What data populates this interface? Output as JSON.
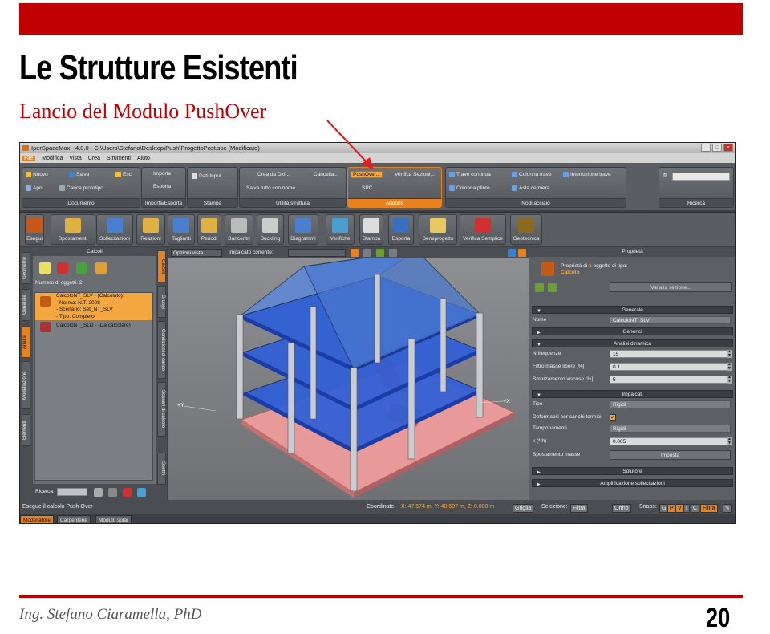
{
  "slide": {
    "title": "Le Strutture Esistenti",
    "subtitle": "Lancio del Modulo PushOver",
    "author": "Ing. Stefano Ciaramella, PhD",
    "page_number": "20",
    "accent_color": "#c00000"
  },
  "window": {
    "title": "IperSpaceMax - 4.0.0 - C:\\Users\\Stefano\\Desktop\\Push\\ProgettoPost.spc (Modificato)"
  },
  "menu": [
    "File",
    "Modifica",
    "Vista",
    "Crea",
    "Strumenti",
    "Aiuto"
  ],
  "ribbon": {
    "documento": {
      "label": "Documento",
      "nuovo": "Nuovo",
      "salva": "Salva",
      "esci": "Esci",
      "apri": "Apri...",
      "carica": "Carica prototipo..."
    },
    "importa": {
      "label": "Importa/Esporta",
      "importa": "Importa",
      "esporta": "Esporta"
    },
    "stampa": {
      "label": "Stampa",
      "dati": "Dati Input"
    },
    "utilita": {
      "label": "Utilità struttura",
      "crea": "Crea da Dxf...",
      "cancella": "Cancella...",
      "salva": "Salva tutto con nome..."
    },
    "addons": {
      "label": "Addons",
      "pushover": "PushOver...",
      "verifica": "Verifica Sezioni...",
      "spc": "SPC..."
    },
    "nodi": {
      "label": "Nodi acciaio",
      "trave_continua": "Trave continua",
      "colonna_trave": "Colonna trave",
      "interruzione": "Interruzione trave",
      "colonna_plinto": "Colonna plinto",
      "asta_cerniera": "Asta cerniera"
    },
    "ricerca": {
      "label": "Ricerca"
    }
  },
  "toolbar": [
    "Esegui",
    "Spostamenti",
    "Sollecitazioni",
    "Reazioni",
    "Taglianti",
    "Periodi",
    "Baricentri",
    "Buckling",
    "Diagrammi",
    "Verifiche",
    "Stampa",
    "Esporta",
    "Semiprogetto",
    "Verifica Semplice",
    "Geotecnica"
  ],
  "left_tabs": [
    "Geometrie",
    "Generale",
    "Analisi",
    "Modellazione",
    "Elementi"
  ],
  "calc_panel": {
    "header": "Calcoli",
    "num_objects": "Numero di oggetti: 2",
    "items": [
      {
        "lines": [
          "CalcoloNT_SLV - (Calcolato):",
          " - Norma: N.T. 2008",
          " - Scenario: Set_NT_SLV",
          " - Tipo: Completo"
        ]
      },
      {
        "lines": [
          "CalcoloNT_SLD - (Da calcolare)"
        ]
      }
    ],
    "search_label": "Ricerca:"
  },
  "mid_tabs": [
    "Calcoli",
    "Gruppi",
    "Condizioni di carico",
    "Scenari di calcolo",
    "Spettri"
  ],
  "viewport": {
    "options": "Opzioni vista...",
    "impalcato": "Impalcato corrente:",
    "axis_x": "+X",
    "axis_y": "+Y"
  },
  "properties": {
    "header": "Proprietà",
    "info_line1": "Proprietà di ",
    "info_count": "1",
    "info_line1b": " oggetto di tipo:",
    "info_type": "Calcolo",
    "vai": "Vai alla sezione...",
    "sections": {
      "generale": "Generale",
      "generici": "Generici",
      "analisi": "Analisi dinamica",
      "impalcati": "Impalcati",
      "solutore": "Solutore",
      "amplificazione": "Amplificazione sollecitazioni"
    },
    "nome_label": "Nome",
    "nome_value": "CalcoloNT_SLV",
    "n_freq_label": "N frequenze",
    "n_freq_value": "15",
    "filtro_label": "Filtro masse libere [%]",
    "filtro_value": "0.1",
    "smorz_label": "Smorzamento viscoso [%]",
    "smorz_value": "5",
    "tipo_label": "Tipo",
    "tipo_value": "Rigidi",
    "deform_label": "Deformabili per carichi termici",
    "tamp_label": "Tamponamenti",
    "tamp_value": "Rigidi",
    "k_label": "k (* h)",
    "k_value": "0.005",
    "sposta_label": "Spostamento masse",
    "imposta": "Imposta"
  },
  "status": {
    "message": "Esegue il calcolo Push Over",
    "coord_label": "Coordinate:",
    "coord_value": "X: 47.574 m, Y: 40.607 m, Z: 0.000 m",
    "griglia": "Griglia",
    "selezione": "Selezione:",
    "filtra": "Filtra",
    "ortho": "Ortho",
    "snaps": "Snaps:",
    "snap_keys": [
      "G",
      "P",
      "V",
      "I",
      "C"
    ],
    "filtra2": "Filtra"
  },
  "bottom_tabs": [
    "Modellatore",
    "Carpenterie",
    "Modulo solai"
  ]
}
